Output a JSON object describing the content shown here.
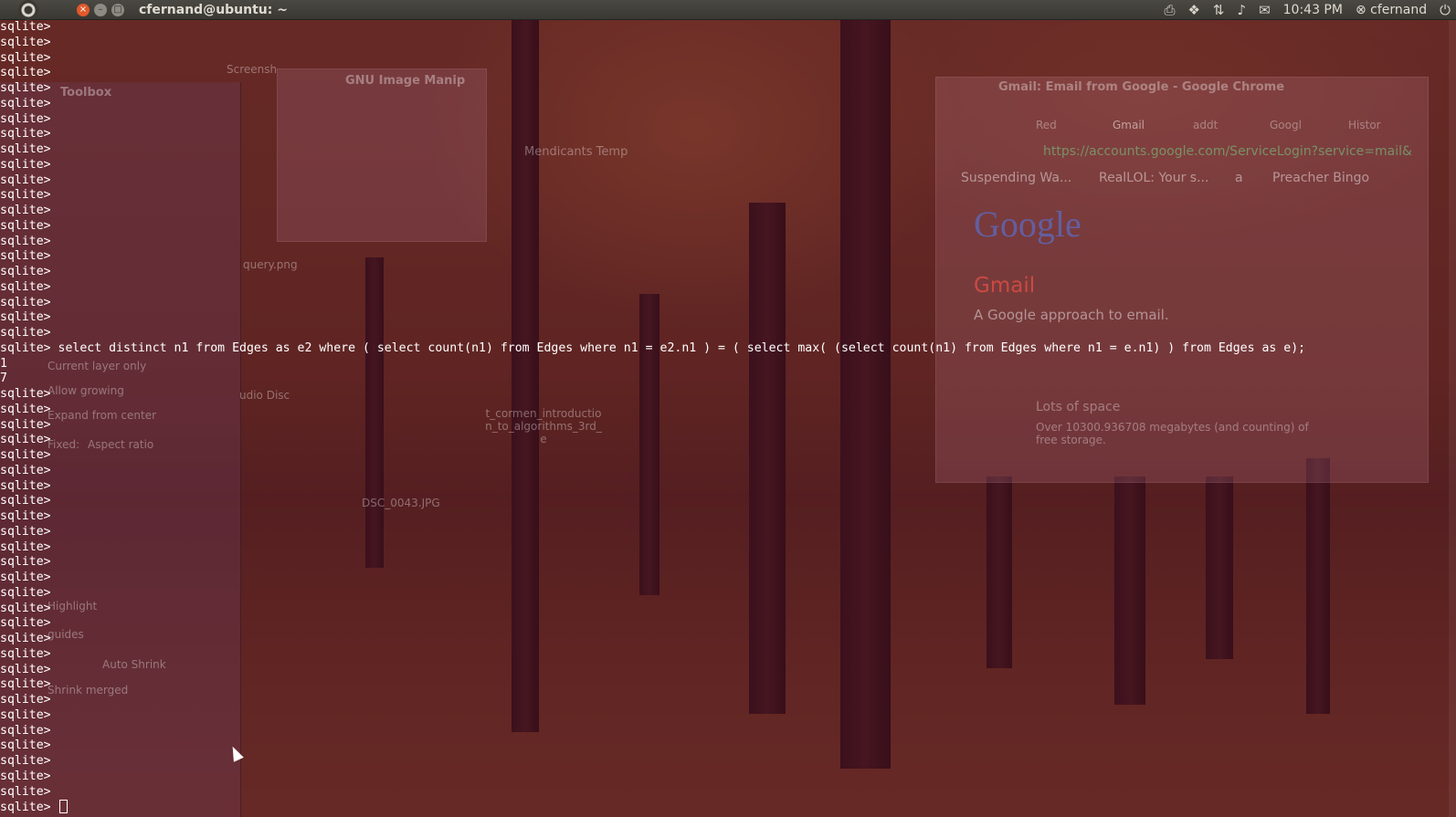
{
  "panel": {
    "title": "cfernand@ubuntu: ~",
    "clock": "10:43 PM",
    "user": "cfernand",
    "icons": [
      "printer-icon",
      "dropbox-icon",
      "network-icon",
      "volume-icon",
      "mail-icon",
      "power-icon"
    ]
  },
  "terminal": {
    "prompt": "sqlite>",
    "lines_before": 21,
    "query": " select distinct n1 from Edges as e2 where ( select count(n1) from Edges where n1 = e2.n1 ) = ( select max( (select count(n1) from Edges where n1 = e.n1) ) from Edges as e);",
    "results": [
      "1",
      "7"
    ],
    "lines_after": 27
  },
  "background": {
    "gimp_title": "GNU Image Manip",
    "toolbox_title": "Toolbox",
    "chrome_title": "Gmail: Email from Google - Google Chrome",
    "chrome_tabs": [
      "Red",
      "Gmail",
      "addt",
      "Googl",
      "Histor"
    ],
    "address": "https://accounts.google.com/ServiceLogin?service=mail&",
    "bookmarks": [
      "Suspending Wa...",
      "RealLOL: Your s...",
      "a",
      "Preacher Bingo"
    ],
    "google": "Google",
    "gmail_heading": "Gmail",
    "gmail_subtitle": "A Google approach to email.",
    "lots_of_space": "Lots of space",
    "storage_text": "Over 10300.936708 megabytes (and counting) of free storage.",
    "desktop_items": [
      "Screensh",
      "Mendicants Temp",
      "udio Disc",
      "t_cormen_introduction_to_algorithms_3rd_e",
      "DSC_0043.JPG",
      "query.png"
    ],
    "gimp_options": [
      "Current layer only",
      "Allow growing",
      "Expand from center",
      "Fixed:",
      "Aspect ratio",
      "Highlight",
      "guides",
      "Auto Shrink",
      "Shrink merged"
    ]
  }
}
